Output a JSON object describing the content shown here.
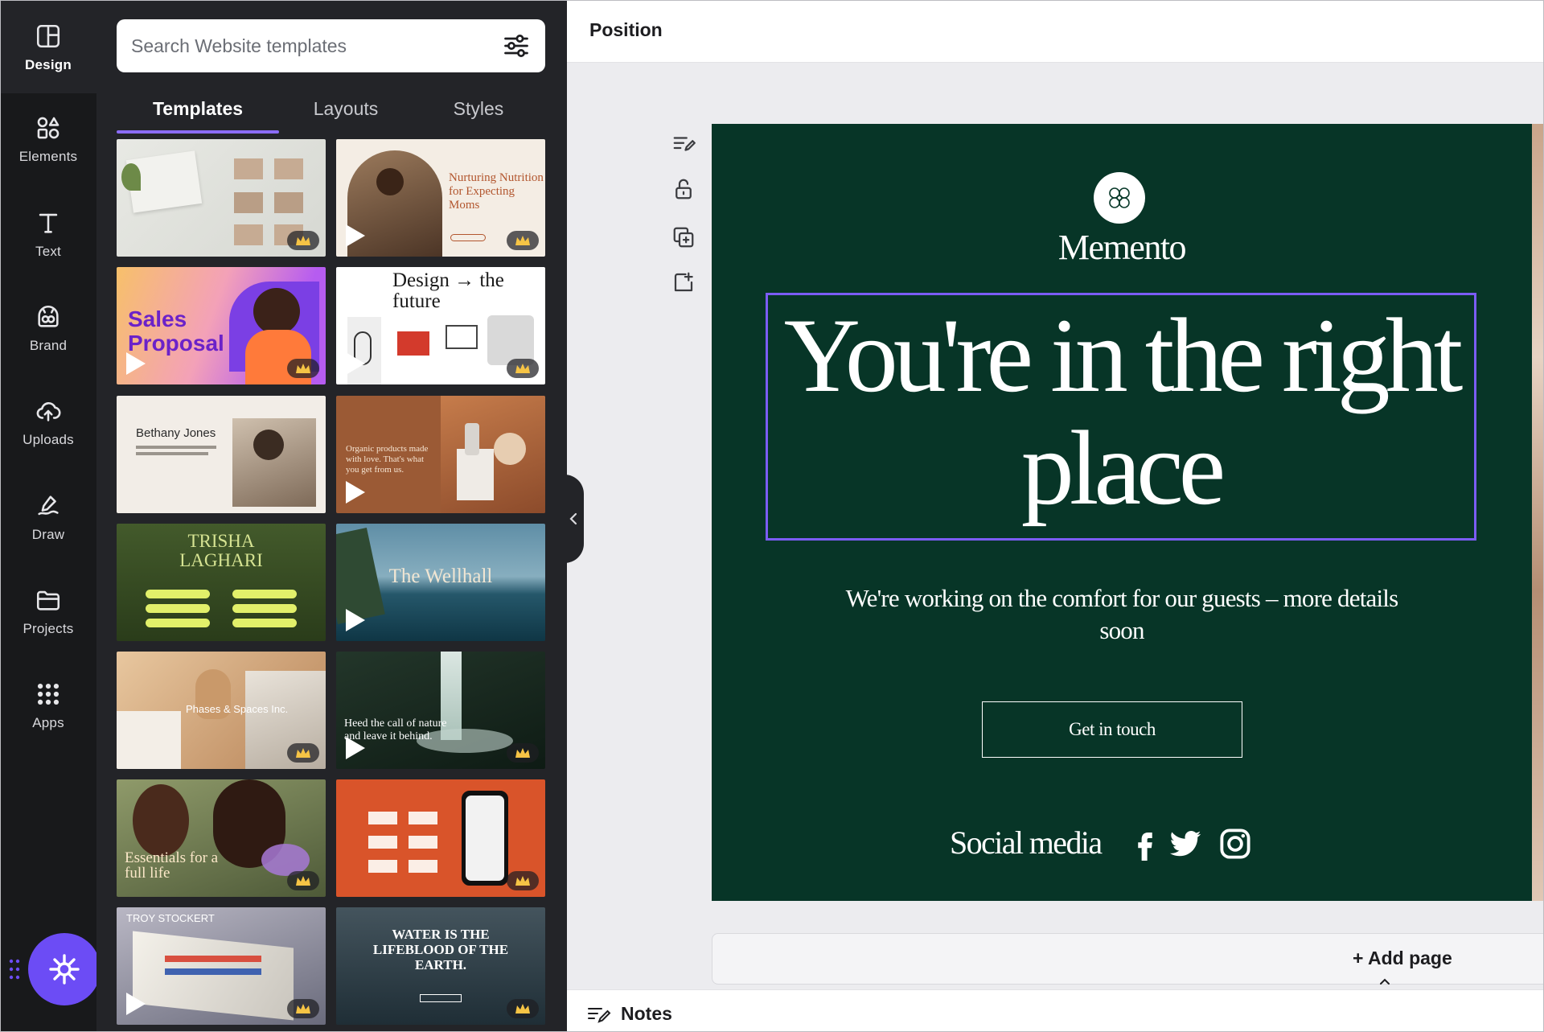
{
  "rail": {
    "items": [
      {
        "label": "Design",
        "icon": "design-icon"
      },
      {
        "label": "Elements",
        "icon": "elements-icon"
      },
      {
        "label": "Text",
        "icon": "text-icon"
      },
      {
        "label": "Brand",
        "icon": "brand-icon"
      },
      {
        "label": "Uploads",
        "icon": "uploads-icon"
      },
      {
        "label": "Draw",
        "icon": "draw-icon"
      },
      {
        "label": "Projects",
        "icon": "projects-icon"
      },
      {
        "label": "Apps",
        "icon": "apps-icon"
      }
    ],
    "active": "Design"
  },
  "search": {
    "placeholder": "Search Website templates"
  },
  "tabs": [
    {
      "label": "Templates",
      "active": true
    },
    {
      "label": "Layouts",
      "active": false
    },
    {
      "label": "Styles",
      "active": false
    }
  ],
  "templates": [
    {
      "text": "",
      "premium": true,
      "video": false
    },
    {
      "text": "Nurturing Nutrition for Expecting Moms",
      "premium": true,
      "video": true
    },
    {
      "text": "Sales Proposal",
      "premium": true,
      "video": true
    },
    {
      "text": "Design → the future",
      "premium": true,
      "video": true
    },
    {
      "text": "Bethany Jones",
      "premium": false,
      "video": false
    },
    {
      "text": "Organic products made with love. That's what you get from us.",
      "premium": false,
      "video": true
    },
    {
      "text": "TRISHA LAGHARI",
      "premium": false,
      "video": false
    },
    {
      "text": "The Wellhall",
      "premium": false,
      "video": true
    },
    {
      "text": "Phases & Spaces Inc.",
      "premium": true,
      "video": false
    },
    {
      "text": "Heed the call of nature and leave it behind.",
      "premium": true,
      "video": true
    },
    {
      "text": "Essentials for a full life",
      "premium": true,
      "video": false
    },
    {
      "text": "",
      "premium": true,
      "video": false
    },
    {
      "text": "TROY STOCKERT",
      "premium": true,
      "video": true
    },
    {
      "text": "WATER IS THE LIFEBLOOD OF THE EARTH.",
      "premium": true,
      "video": false
    }
  ],
  "topbar": {
    "title": "Position"
  },
  "design": {
    "brand": "Memento",
    "headline": "You're in the right place",
    "subtext": "We're working on the comfort for our guests – more details soon",
    "cta": "Get in touch",
    "social_label": "Social media",
    "social_icons": [
      "facebook-icon",
      "twitter-icon",
      "instagram-icon"
    ],
    "background": "#073527",
    "selection_color": "#7b5cf5"
  },
  "bottom": {
    "add_page": "+ Add page",
    "notes": "Notes"
  }
}
